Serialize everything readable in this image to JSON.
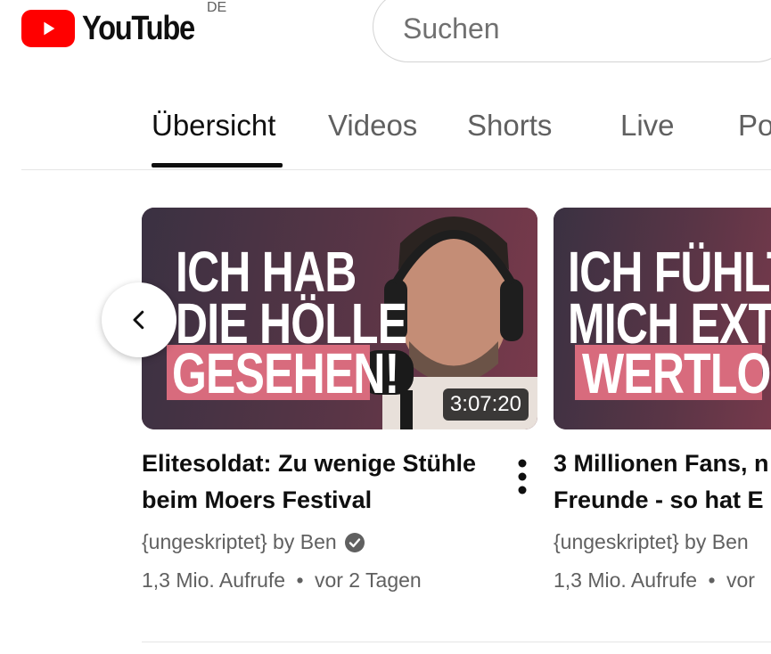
{
  "header": {
    "logo_text": "YouTube",
    "country_code": "DE",
    "search_placeholder": "Suchen"
  },
  "tabs": [
    {
      "label": "Übersicht",
      "active": true
    },
    {
      "label": "Videos",
      "active": false
    },
    {
      "label": "Shorts",
      "active": false
    },
    {
      "label": "Live",
      "active": false
    },
    {
      "label": "Po",
      "active": false
    }
  ],
  "videos": [
    {
      "thumb_lines": [
        "ICH HAB",
        "DIE HÖLLE",
        "GESEHEN!"
      ],
      "duration": "3:07:20",
      "title_line1": "Elitesoldat: Zu wenige Stühle",
      "title_line2": "beim Moers Festival",
      "channel": "{ungeskriptet} by Ben",
      "views": "1,3 Mio. Aufrufe",
      "age": "vor 2 Tagen"
    },
    {
      "thumb_lines": [
        "ICH FÜHLTE",
        "MICH EXTREM",
        "WERTLOS!"
      ],
      "title_line1": "3 Millionen Fans, n",
      "title_line2": "Freunde - so hat E",
      "channel": "{ungeskriptet} by Ben",
      "views": "1,3 Mio. Aufrufe",
      "age": "vor"
    }
  ],
  "colors": {
    "brand_red": "#ff0000",
    "thumb_accent": "#d86b7d",
    "verified": "#606060"
  },
  "icons": {
    "prev": "chevron-left-icon",
    "more": "more-vert-icon",
    "verified": "verified-check-icon"
  }
}
